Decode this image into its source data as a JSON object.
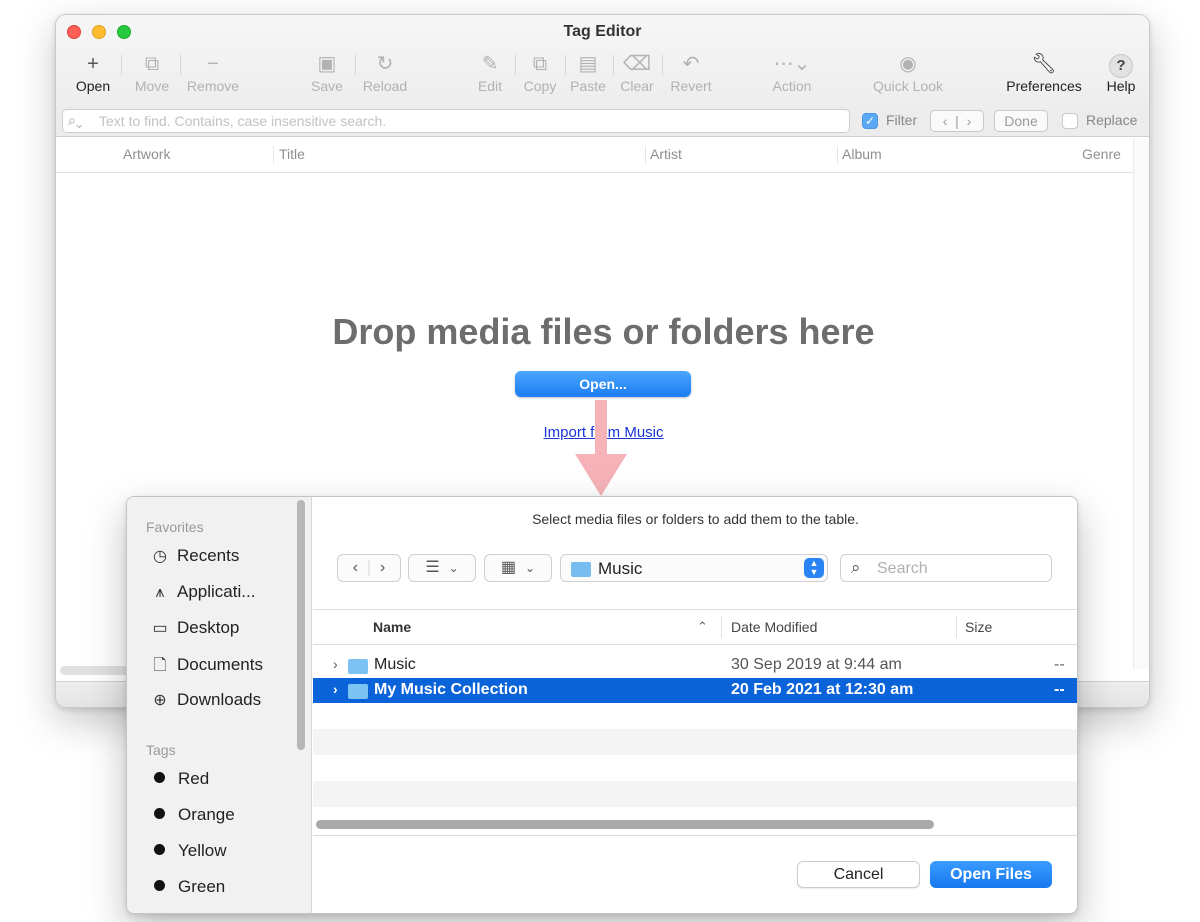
{
  "window": {
    "title": "Tag Editor"
  },
  "toolbar": {
    "open": "Open",
    "move": "Move",
    "remove": "Remove",
    "save": "Save",
    "reload": "Reload",
    "edit": "Edit",
    "copy": "Copy",
    "paste": "Paste",
    "clear": "Clear",
    "revert": "Revert",
    "action": "Action",
    "quick_look": "Quick Look",
    "preferences": "Preferences",
    "help": "Help"
  },
  "findbar": {
    "placeholder": "Text to find. Contains, case insensitive search.",
    "filter_label": "Filter",
    "filter_checked": true,
    "done_label": "Done",
    "replace_label": "Replace",
    "replace_checked": false
  },
  "table": {
    "columns": [
      "Artwork",
      "Title",
      "Artist",
      "Album",
      "Genre"
    ]
  },
  "drop_zone": {
    "title": "Drop media files or folders here",
    "open_button": "Open...",
    "import_link": "Import from Music"
  },
  "open_panel": {
    "message": "Select media files or folders to add them to the table.",
    "sidebar": {
      "favorites_heading": "Favorites",
      "favorites": [
        "Recents",
        "Applicati...",
        "Desktop",
        "Documents",
        "Downloads"
      ],
      "tags_heading": "Tags",
      "tags": [
        "Red",
        "Orange",
        "Yellow",
        "Green"
      ]
    },
    "location": "Music",
    "search_placeholder": "Search",
    "columns": {
      "name": "Name",
      "date_modified": "Date Modified",
      "size": "Size"
    },
    "rows": [
      {
        "name": "Music",
        "date": "30 Sep 2019 at 9:44 am",
        "size": "--",
        "selected": false
      },
      {
        "name": "My Music Collection",
        "date": "20 Feb 2021 at 12:30 am",
        "size": "--",
        "selected": true
      }
    ],
    "cancel_button": "Cancel",
    "open_files_button": "Open Files"
  },
  "colors": {
    "accent": "#1c7cf2",
    "selection": "#0a63d8",
    "arrow": "#f5b3b8",
    "link": "#1a35d8"
  }
}
